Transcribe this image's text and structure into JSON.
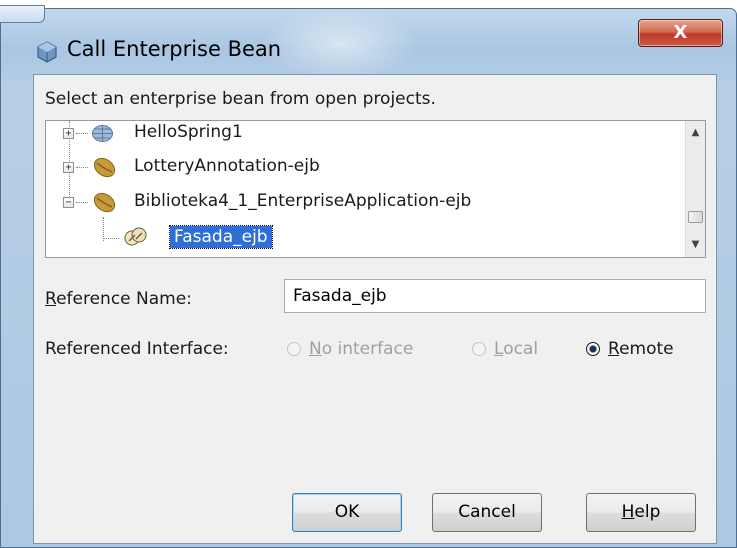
{
  "window": {
    "title": "Call Enterprise Bean",
    "close_label": "X"
  },
  "instruction": "Select an enterprise bean from open projects.",
  "tree": {
    "items": [
      {
        "label": "HelloSpring1",
        "icon": "web-module-icon",
        "expanded": false
      },
      {
        "label": "LotteryAnnotation-ejb",
        "icon": "bean-icon",
        "expanded": false
      },
      {
        "label": "Biblioteka4_1_EnterpriseApplication-ejb",
        "icon": "bean-icon",
        "expanded": true
      },
      {
        "label": "Fasada_ejb",
        "icon": "session-bean-icon",
        "selected": true
      }
    ],
    "expander_collapsed": "+",
    "expander_expanded": "−"
  },
  "reference_name": {
    "label_prefix": "R",
    "label_rest": "eference Name:",
    "value": "Fasada_ejb"
  },
  "referenced_interface": {
    "label": "Referenced Interface:",
    "options": [
      {
        "mnemonic": "N",
        "rest": "o interface",
        "enabled": false,
        "selected": false
      },
      {
        "mnemonic": "L",
        "rest": "ocal",
        "enabled": false,
        "selected": false
      },
      {
        "mnemonic": "R",
        "rest": "emote",
        "enabled": true,
        "selected": true
      }
    ]
  },
  "buttons": {
    "ok": "OK",
    "cancel": "Cancel",
    "help_mnemonic": "H",
    "help_rest": "elp"
  },
  "colors": {
    "selection": "#2e6fd6",
    "close_button": "#c0392a",
    "frame": "#adc8e3"
  }
}
